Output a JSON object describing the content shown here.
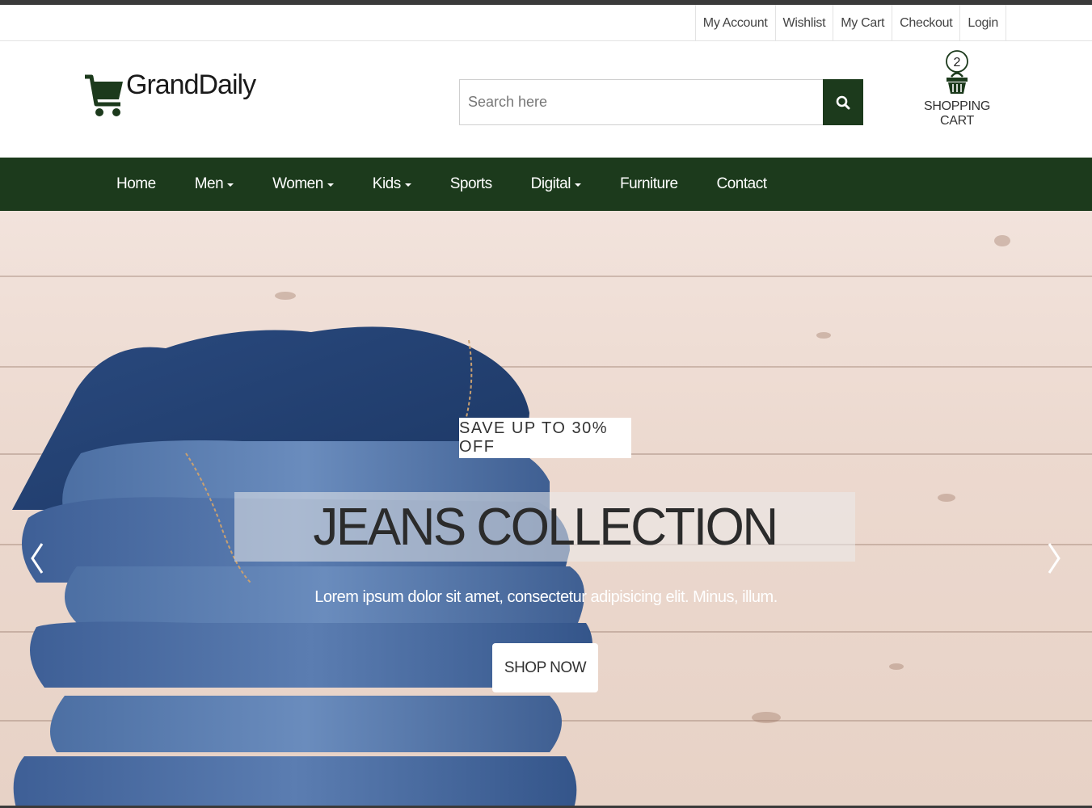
{
  "top_links": [
    "My Account",
    "Wishlist",
    "My Cart",
    "Checkout",
    "Login"
  ],
  "logo": {
    "text": "GrandDaily",
    "icon": "cart-icon"
  },
  "search": {
    "placeholder": "Search here",
    "icon": "search-icon"
  },
  "cart": {
    "count": "2",
    "label": "SHOPPING CART",
    "icon": "basket-icon"
  },
  "nav": {
    "items": [
      {
        "label": "Home",
        "dropdown": false
      },
      {
        "label": "Men",
        "dropdown": true
      },
      {
        "label": "Women",
        "dropdown": true
      },
      {
        "label": "Kids",
        "dropdown": true
      },
      {
        "label": "Sports",
        "dropdown": false
      },
      {
        "label": "Digital",
        "dropdown": true
      },
      {
        "label": "Furniture",
        "dropdown": false
      },
      {
        "label": "Contact",
        "dropdown": false
      }
    ]
  },
  "hero": {
    "tag": "SAVE UP TO 30% OFF",
    "title": "JEANS COLLECTION",
    "subtitle": "Lorem ipsum dolor sit amet, consectetur adipisicing elit. Minus, illum.",
    "button": "SHOP NOW",
    "prev_icon": "chevron-left-icon",
    "next_icon": "chevron-right-icon"
  },
  "colors": {
    "brand": "#1c3a1c",
    "topbar": "#3a3a3a"
  }
}
